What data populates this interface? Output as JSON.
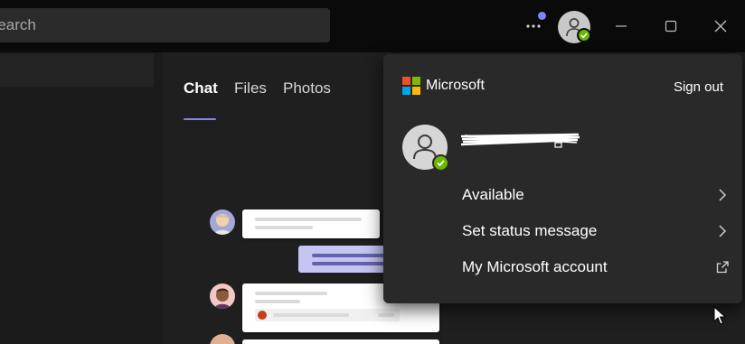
{
  "titlebar": {
    "search_text": "Search",
    "more_icon": "more-horizontal-icon",
    "notification_dot_color": "#7f85f5",
    "avatar_icon": "person-icon",
    "presence_status": "available",
    "presence_color": "#6bb700"
  },
  "window_controls": [
    "minimize",
    "maximize",
    "close"
  ],
  "tabs": [
    {
      "label": "Chat",
      "active": true
    },
    {
      "label": "Files",
      "active": false
    },
    {
      "label": "Photos",
      "active": false
    }
  ],
  "accent_color": "#7f85f5",
  "account_menu": {
    "brand": "Microsoft",
    "sign_out_label": "Sign out",
    "user_presence": "available",
    "items": [
      {
        "label": "Available",
        "icon": "chevron-right-icon"
      },
      {
        "label": "Set status message",
        "icon": "chevron-right-icon"
      },
      {
        "label": "My Microsoft account",
        "icon": "external-link-icon"
      }
    ]
  }
}
